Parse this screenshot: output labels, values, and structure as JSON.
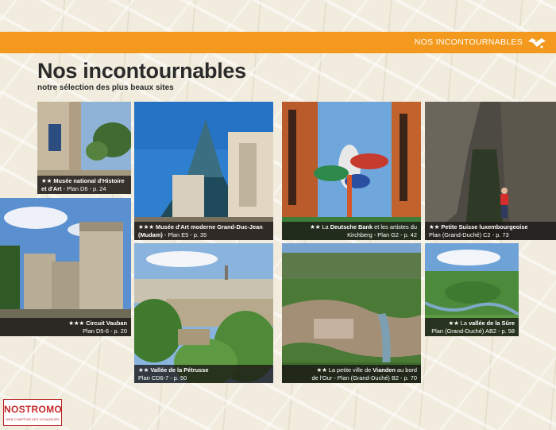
{
  "header": {
    "section_label": "NOS INCONTOURNABLES",
    "title": "Nos incontournables",
    "subtitle": "notre sélection des plus beaux sites"
  },
  "sites": [
    {
      "stars": "★★",
      "name": "Musée national d'Histoire et d'Art",
      "ref": " - Plan D6 - p. 24"
    },
    {
      "stars": "★★★",
      "name": "Musée d'Art moderne Grand-Duc-Jean (Mudam)",
      "ref": " - Plan E5 - p. 35"
    },
    {
      "stars": "★★",
      "pre": " La ",
      "name": "Deutsche Bank",
      "mid": " et les artistes du",
      "ref": "Kirchberg - Plan G2 - p. 42"
    },
    {
      "stars": "★★",
      "name": "Petite Suisse luxembourgeoise",
      "ref": "Plan (Grand-Duché) C2 - p. 73"
    },
    {
      "stars": "★★★",
      "name": "Circuit Vauban",
      "ref": "Plan D5-6 - p. 20"
    },
    {
      "stars": "★★",
      "name": "Vallée de la Pétrusse",
      "ref": "Plan CD6-7 - p. 50"
    },
    {
      "stars": "★★",
      "pre": " La petite ville de ",
      "name": "Vianden",
      "mid": " au bord",
      "ref": "de l'Our - Plan (Grand-Duché) B2 - p. 70"
    },
    {
      "stars": "★★",
      "pre": " La ",
      "name": "vallée de la Sûre",
      "ref": "Plan (Grand-Duché) AB2 - p. 58"
    }
  ],
  "watermark": {
    "brand": "NOSTROMO",
    "tagline": "WEB COMPTOIR DES VOYAGEURS"
  },
  "colors": {
    "accent": "#f39a1e",
    "caption_bg": "#19161499"
  },
  "icons": {
    "section_icon": "handshake-icon"
  }
}
